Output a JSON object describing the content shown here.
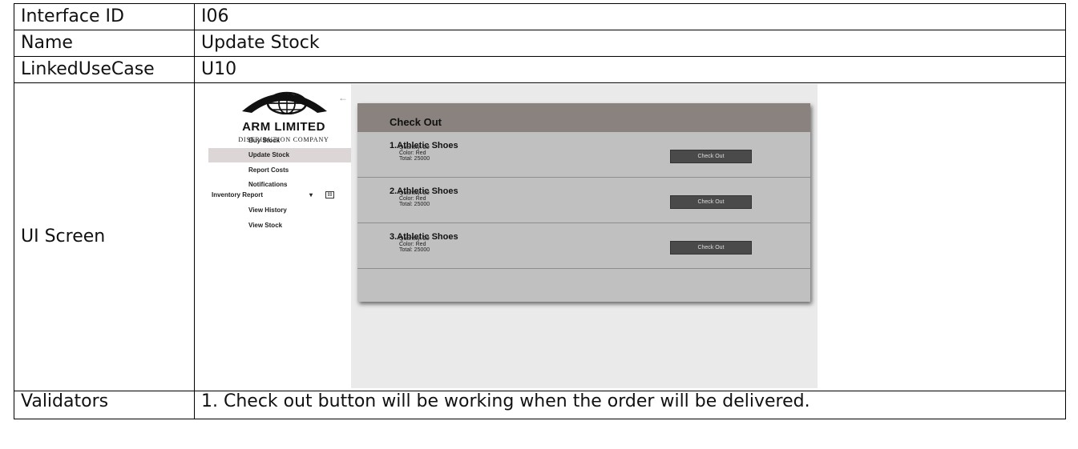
{
  "spec": {
    "rows": [
      {
        "key": "Interface ID",
        "value": "I06"
      },
      {
        "key": "Name",
        "value": "Update Stock"
      },
      {
        "key": "LinkedUseCase",
        "value": "U10"
      }
    ],
    "ui_screen_label": "UI Screen",
    "validators_label": "Validators",
    "validators_text": "1. Check out button will be working when the order will be delivered."
  },
  "screen": {
    "logo_name": "ARM LIMITED",
    "logo_sub": "DISTRIBUTION COMPANY",
    "back_icon": "←",
    "nav": [
      "Buy Stock",
      "Update Stock",
      "Report Costs",
      "Notifications",
      "Inventory Report",
      "View History",
      "View Stock"
    ],
    "active_nav": "Update Stock",
    "panel_title": "Check Out",
    "items": [
      {
        "title": "1.Athletic Shoes",
        "quantity": "Quantity: 20",
        "color": "Color: Red",
        "total": "Total: 25000",
        "button": "Check Out"
      },
      {
        "title": "2.Athletic Shoes",
        "quantity": "Quantity: 20",
        "color": "Color: Red",
        "total": "Total: 25000",
        "button": "Check Out"
      },
      {
        "title": "3.Athletic Shoes",
        "quantity": "Quantity: 20",
        "color": "Color: Red",
        "total": "Total: 25000",
        "button": "Check Out"
      }
    ]
  }
}
